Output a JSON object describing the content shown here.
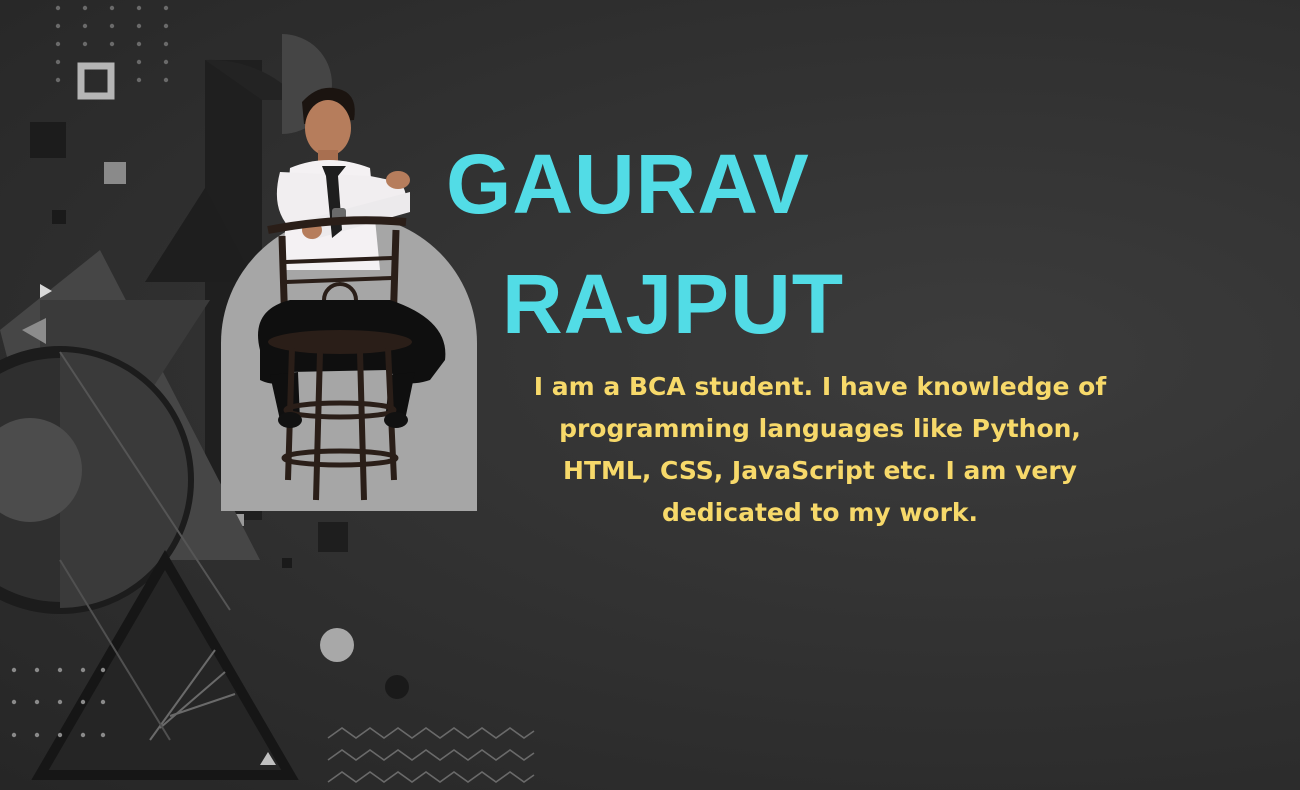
{
  "profile": {
    "first_name": "GAURAV",
    "last_name": "RAJPUT",
    "bio": "I am a BCA student. I have knowledge of programming languages like Python, HTML, CSS, JavaScript etc. I am very dedicated to my work."
  },
  "colors": {
    "background": "#303030",
    "name": "#52dce6",
    "bio": "#f7d96a",
    "photo_frame": "#a6a6a6"
  },
  "icons": [
    "dot-grid-icon",
    "square-outline-icon",
    "triangle-icon",
    "play-arrow-icon",
    "half-circle-icon",
    "circle-icon",
    "zigzag-pattern-icon"
  ]
}
